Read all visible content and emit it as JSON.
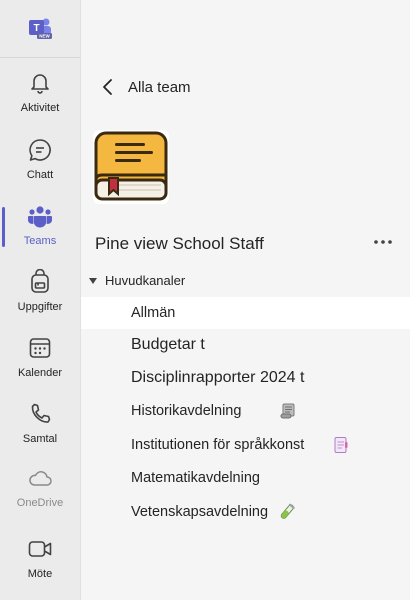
{
  "rail": {
    "items": [
      {
        "label": "Aktivitet",
        "icon": "bell-icon"
      },
      {
        "label": "Chatt",
        "icon": "chat-icon"
      },
      {
        "label": "Teams",
        "icon": "teams-icon"
      },
      {
        "label": "Uppgifter",
        "icon": "backpack-icon"
      },
      {
        "label": "Kalender",
        "icon": "calendar-icon"
      },
      {
        "label": "Samtal",
        "icon": "phone-icon"
      },
      {
        "label": "OneDrive",
        "icon": "cloud-icon"
      },
      {
        "label": "Möte",
        "icon": "video-icon"
      }
    ],
    "active": "Teams"
  },
  "panel": {
    "back_label": "Alla team",
    "team_name": "Pine view School Staff",
    "section_label": "Huvudkanaler",
    "channels": [
      {
        "name": "Allmän",
        "selected": true,
        "icon": ""
      },
      {
        "name": "Budgetar t",
        "selected": false,
        "icon": ""
      },
      {
        "name": "Disciplinrapporter 2024 t",
        "selected": false,
        "icon": ""
      },
      {
        "name": "Historikavdelning",
        "selected": false,
        "icon": "scroll-icon"
      },
      {
        "name": "Institutionen för språkkonst",
        "selected": false,
        "icon": "notebook-icon"
      },
      {
        "name": "Matematikavdelning",
        "selected": false,
        "icon": ""
      },
      {
        "name": "Vetenskapsavdelning",
        "selected": false,
        "icon": "test-tube-icon"
      }
    ]
  },
  "colors": {
    "accent": "#5b5fc7",
    "rail_bg": "#ebebeb",
    "panel_bg": "#f5f5f5",
    "book_cover": "#f4b73f"
  }
}
